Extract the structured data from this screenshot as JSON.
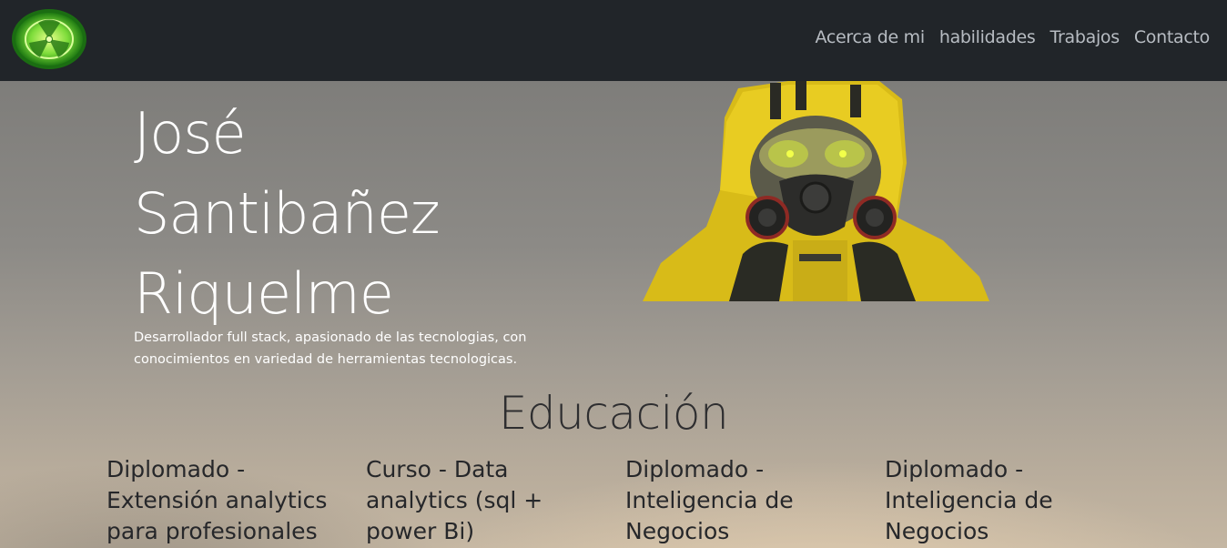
{
  "nav": {
    "logo_icon": "radioactive-icon",
    "links": [
      {
        "label": "Acerca de mi"
      },
      {
        "label": "habilidades"
      },
      {
        "label": "Trabajos"
      },
      {
        "label": "Contacto"
      }
    ]
  },
  "hero": {
    "name_lines": [
      "José",
      "Santibañez",
      "Riquelme"
    ],
    "description": "Desarrollador full stack, apasionado de las tecnologias, con conocimientos en variedad de herramientas tecnologicas.",
    "image_icon": "hazmat-figure-illustration"
  },
  "education": {
    "title": "Educación",
    "cards": [
      {
        "title": "Diplomado - Extensión analytics para profesionales"
      },
      {
        "title": "Curso - Data analytics (sql + power Bi)"
      },
      {
        "title": "Diplomado - Inteligencia de Negocios"
      },
      {
        "title": "Diplomado - Inteligencia de Negocios"
      }
    ]
  },
  "colors": {
    "navbar": "#212529",
    "nav_link": "#b7bcc2",
    "logo_green": "#3fbf2a",
    "hazmat_yellow": "#e5c61b"
  }
}
